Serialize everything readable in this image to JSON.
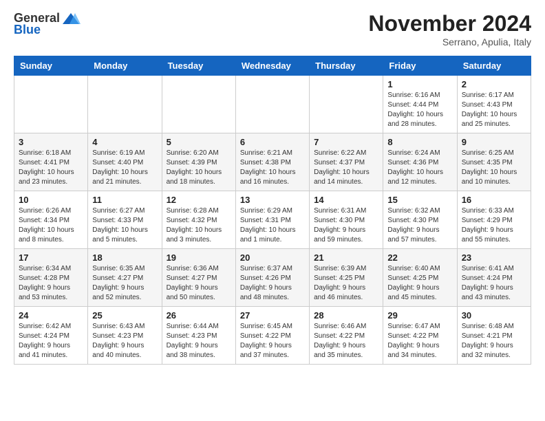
{
  "header": {
    "logo_general": "General",
    "logo_blue": "Blue",
    "month_title": "November 2024",
    "subtitle": "Serrano, Apulia, Italy"
  },
  "days_of_week": [
    "Sunday",
    "Monday",
    "Tuesday",
    "Wednesday",
    "Thursday",
    "Friday",
    "Saturday"
  ],
  "weeks": [
    [
      {
        "day": "",
        "info": ""
      },
      {
        "day": "",
        "info": ""
      },
      {
        "day": "",
        "info": ""
      },
      {
        "day": "",
        "info": ""
      },
      {
        "day": "",
        "info": ""
      },
      {
        "day": "1",
        "info": "Sunrise: 6:16 AM\nSunset: 4:44 PM\nDaylight: 10 hours and 28 minutes."
      },
      {
        "day": "2",
        "info": "Sunrise: 6:17 AM\nSunset: 4:43 PM\nDaylight: 10 hours and 25 minutes."
      }
    ],
    [
      {
        "day": "3",
        "info": "Sunrise: 6:18 AM\nSunset: 4:41 PM\nDaylight: 10 hours and 23 minutes."
      },
      {
        "day": "4",
        "info": "Sunrise: 6:19 AM\nSunset: 4:40 PM\nDaylight: 10 hours and 21 minutes."
      },
      {
        "day": "5",
        "info": "Sunrise: 6:20 AM\nSunset: 4:39 PM\nDaylight: 10 hours and 18 minutes."
      },
      {
        "day": "6",
        "info": "Sunrise: 6:21 AM\nSunset: 4:38 PM\nDaylight: 10 hours and 16 minutes."
      },
      {
        "day": "7",
        "info": "Sunrise: 6:22 AM\nSunset: 4:37 PM\nDaylight: 10 hours and 14 minutes."
      },
      {
        "day": "8",
        "info": "Sunrise: 6:24 AM\nSunset: 4:36 PM\nDaylight: 10 hours and 12 minutes."
      },
      {
        "day": "9",
        "info": "Sunrise: 6:25 AM\nSunset: 4:35 PM\nDaylight: 10 hours and 10 minutes."
      }
    ],
    [
      {
        "day": "10",
        "info": "Sunrise: 6:26 AM\nSunset: 4:34 PM\nDaylight: 10 hours and 8 minutes."
      },
      {
        "day": "11",
        "info": "Sunrise: 6:27 AM\nSunset: 4:33 PM\nDaylight: 10 hours and 5 minutes."
      },
      {
        "day": "12",
        "info": "Sunrise: 6:28 AM\nSunset: 4:32 PM\nDaylight: 10 hours and 3 minutes."
      },
      {
        "day": "13",
        "info": "Sunrise: 6:29 AM\nSunset: 4:31 PM\nDaylight: 10 hours and 1 minute."
      },
      {
        "day": "14",
        "info": "Sunrise: 6:31 AM\nSunset: 4:30 PM\nDaylight: 9 hours and 59 minutes."
      },
      {
        "day": "15",
        "info": "Sunrise: 6:32 AM\nSunset: 4:30 PM\nDaylight: 9 hours and 57 minutes."
      },
      {
        "day": "16",
        "info": "Sunrise: 6:33 AM\nSunset: 4:29 PM\nDaylight: 9 hours and 55 minutes."
      }
    ],
    [
      {
        "day": "17",
        "info": "Sunrise: 6:34 AM\nSunset: 4:28 PM\nDaylight: 9 hours and 53 minutes."
      },
      {
        "day": "18",
        "info": "Sunrise: 6:35 AM\nSunset: 4:27 PM\nDaylight: 9 hours and 52 minutes."
      },
      {
        "day": "19",
        "info": "Sunrise: 6:36 AM\nSunset: 4:27 PM\nDaylight: 9 hours and 50 minutes."
      },
      {
        "day": "20",
        "info": "Sunrise: 6:37 AM\nSunset: 4:26 PM\nDaylight: 9 hours and 48 minutes."
      },
      {
        "day": "21",
        "info": "Sunrise: 6:39 AM\nSunset: 4:25 PM\nDaylight: 9 hours and 46 minutes."
      },
      {
        "day": "22",
        "info": "Sunrise: 6:40 AM\nSunset: 4:25 PM\nDaylight: 9 hours and 45 minutes."
      },
      {
        "day": "23",
        "info": "Sunrise: 6:41 AM\nSunset: 4:24 PM\nDaylight: 9 hours and 43 minutes."
      }
    ],
    [
      {
        "day": "24",
        "info": "Sunrise: 6:42 AM\nSunset: 4:24 PM\nDaylight: 9 hours and 41 minutes."
      },
      {
        "day": "25",
        "info": "Sunrise: 6:43 AM\nSunset: 4:23 PM\nDaylight: 9 hours and 40 minutes."
      },
      {
        "day": "26",
        "info": "Sunrise: 6:44 AM\nSunset: 4:23 PM\nDaylight: 9 hours and 38 minutes."
      },
      {
        "day": "27",
        "info": "Sunrise: 6:45 AM\nSunset: 4:22 PM\nDaylight: 9 hours and 37 minutes."
      },
      {
        "day": "28",
        "info": "Sunrise: 6:46 AM\nSunset: 4:22 PM\nDaylight: 9 hours and 35 minutes."
      },
      {
        "day": "29",
        "info": "Sunrise: 6:47 AM\nSunset: 4:22 PM\nDaylight: 9 hours and 34 minutes."
      },
      {
        "day": "30",
        "info": "Sunrise: 6:48 AM\nSunset: 4:21 PM\nDaylight: 9 hours and 32 minutes."
      }
    ]
  ]
}
